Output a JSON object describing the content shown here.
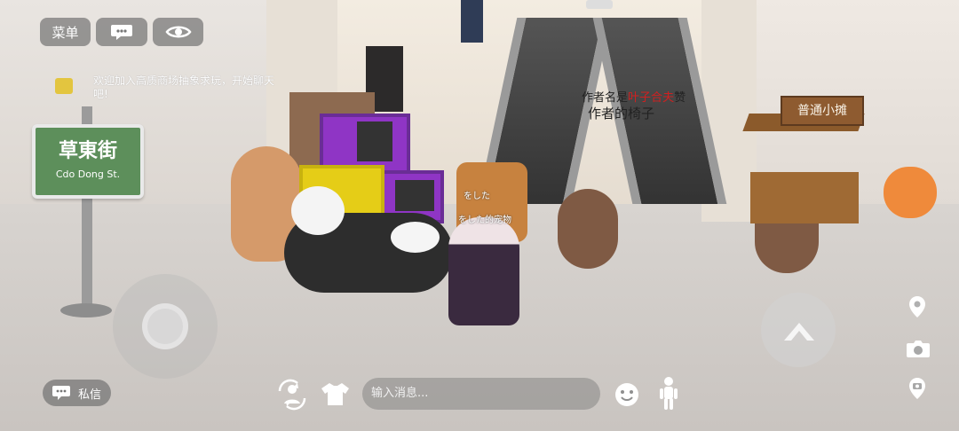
{
  "top_bar": {
    "menu_label": "菜单"
  },
  "chat": {
    "message": "欢迎加入高质商场抽象求玩，开始聊天吧!"
  },
  "scene_texts": {
    "street_sign_big": "草東街",
    "street_sign_small": "Cdo Dong St.",
    "avatar_label_1": "をした",
    "avatar_label_2": "をした的宠物",
    "author_line_1a": "作者名",
    "author_line_1b": "是",
    "author_line_1c": "叶子",
    "author_line_1d": "合",
    "author_line_1e": "夫",
    "author_line_1f": "赞",
    "author_line_2": "作者的椅子",
    "stall_sign": "普通小摊"
  },
  "bottom_bar": {
    "private_chat_label": "私信",
    "input_placeholder": "输入消息..."
  },
  "colors": {
    "hud_bg": "#6e6e6e",
    "sign_green": "#5d8f5b",
    "chat_icon": "#e3c53f"
  }
}
